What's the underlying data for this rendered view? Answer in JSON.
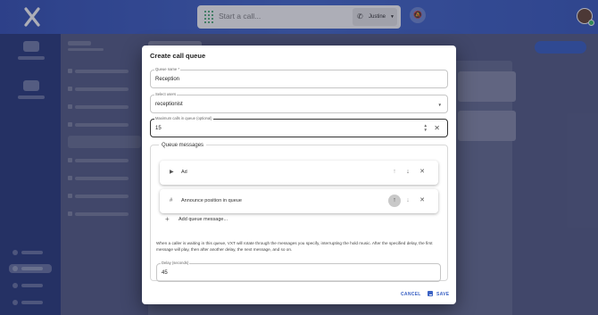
{
  "topbar": {
    "search_placeholder": "Start a call...",
    "user_select": "Justine"
  },
  "dialog": {
    "title": "Create call queue",
    "queue_name": {
      "label": "Queue name *",
      "value": "Reception"
    },
    "select_users": {
      "label": "Select users",
      "value": "receptionist"
    },
    "max_calls": {
      "label": "Maximum calls in queue (optional)",
      "value": "15"
    },
    "queue_messages": {
      "legend": "Queue messages",
      "items": [
        {
          "icon": "play-icon",
          "label": "Ad"
        },
        {
          "icon": "hash-icon",
          "label": "Announce position in queue"
        }
      ],
      "add_label": "Add queue message...",
      "description": "When a caller is waiting in this queue, VXT will rotate through the messages you specify, interrupting the hold music. After the specified delay, the first message will play, then after another delay, the next message, and so on.",
      "delay": {
        "label": "Delay (seconds)",
        "value": "45"
      }
    },
    "cancel_label": "CANCEL",
    "save_label": "SAVE"
  },
  "colors": {
    "accent": "#3b62c4",
    "topbar": "#4a6ed0",
    "online": "#3ec46d",
    "dialpad": "#2a9d5c"
  }
}
